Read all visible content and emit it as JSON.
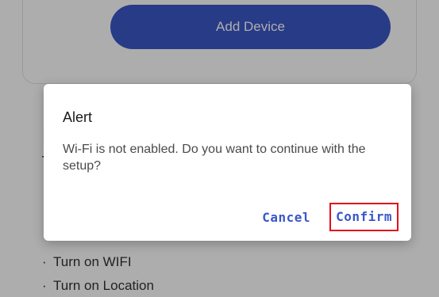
{
  "background": {
    "add_device_label": "Add Device",
    "heading_partial": "F\nf",
    "list_items": [
      {
        "bullet": "·",
        "label": "Turn on WIFI"
      },
      {
        "bullet": "·",
        "label": "Turn on Location"
      }
    ]
  },
  "dialog": {
    "title": "Alert",
    "message": "Wi-Fi is not enabled. Do you want to continue with the setup?",
    "cancel_label": "Cancel",
    "confirm_label": "Confirm"
  },
  "colors": {
    "accent": "#3a57c8",
    "highlight": "#e0101c"
  }
}
